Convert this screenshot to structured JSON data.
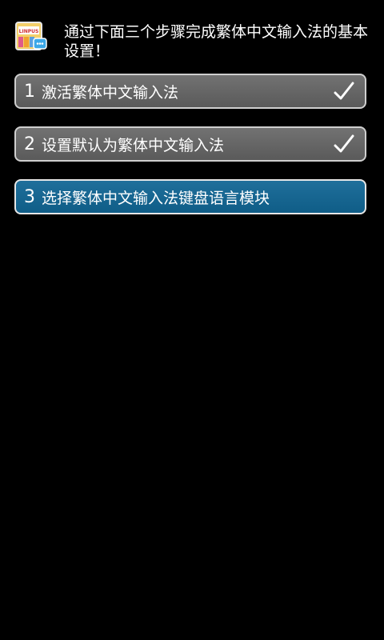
{
  "header": {
    "instruction": "通过下面三个步骤完成繁体中文输入法的基本设置！",
    "app_icon_text": "LINPUS"
  },
  "steps": [
    {
      "number": "1",
      "label": "激活繁体中文输入法",
      "status": "done",
      "icon": "checkmark-icon"
    },
    {
      "number": "2",
      "label": "设置默认为繁体中文输入法",
      "status": "done",
      "icon": "checkmark-icon"
    },
    {
      "number": "3",
      "label": "选择繁体中文输入法键盘语言模块",
      "status": "active"
    }
  ],
  "colors": {
    "background": "#000000",
    "done_step": "#666666",
    "active_step": "#15658f",
    "border": "#cfcfcf"
  }
}
